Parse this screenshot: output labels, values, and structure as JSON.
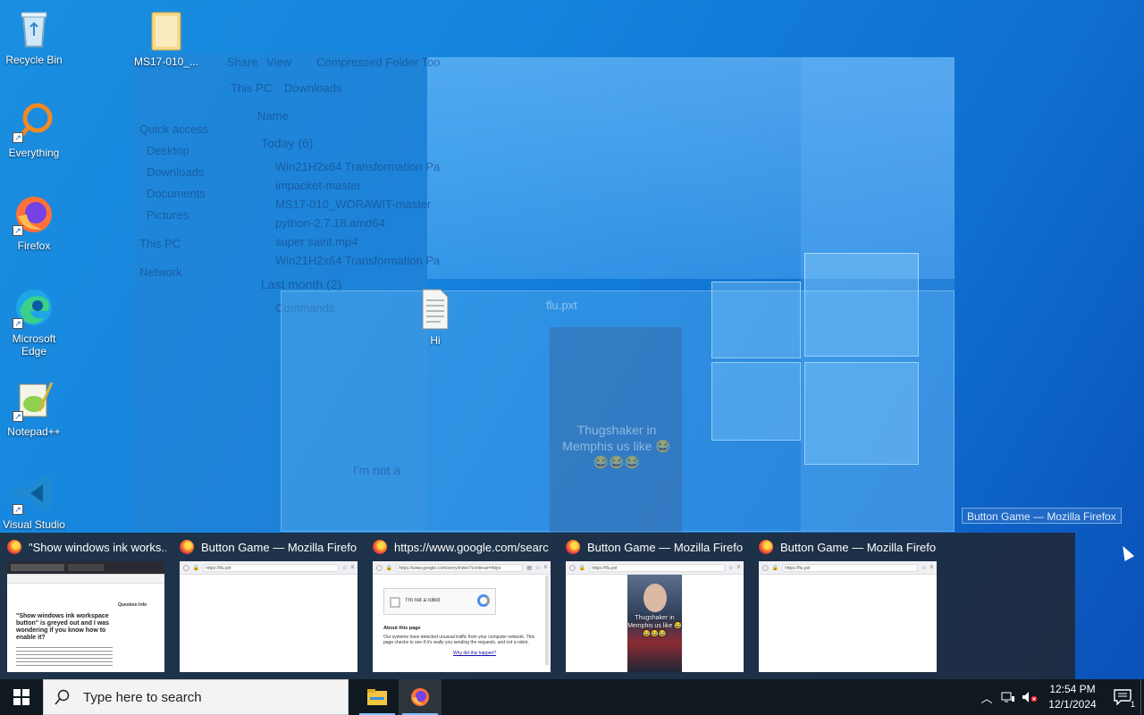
{
  "desktop": {
    "icons": [
      {
        "label": "Recycle Bin",
        "icon": "recycle-bin-icon"
      },
      {
        "label": "MS17-010_...",
        "icon": "folder-icon"
      },
      {
        "label": "Everything",
        "icon": "everything-search-icon"
      },
      {
        "label": "Firefox",
        "icon": "firefox-icon"
      },
      {
        "label": "Microsoft Edge",
        "icon": "edge-icon"
      },
      {
        "label": "Notepad++",
        "icon": "notepadpp-icon"
      },
      {
        "label": "Visual Studio",
        "icon": "vscode-icon"
      },
      {
        "label": "Hi",
        "icon": "text-file-icon"
      }
    ]
  },
  "ghost_explorer": {
    "ribbon": [
      "Share",
      "View",
      "Compressed Folder Too"
    ],
    "path": [
      "This PC",
      "Downloads"
    ],
    "column_header": "Name",
    "nav": [
      "Quick access",
      "Desktop",
      "Downloads",
      "Documents",
      "Pictures",
      "This PC",
      "Network"
    ],
    "group_today": "Today (6)",
    "files_today": [
      "Win21H2x64 Transformation Pa",
      "impacket-master",
      "MS17-010_WORAWIT-master",
      "python-2.7.18.amd64",
      "super saint.mp4",
      "Win21H2x64 Transformation Pa"
    ],
    "group_last_month": "Last month (2)",
    "files_last_month": [
      "Commands"
    ]
  },
  "ghost_browser": {
    "url": "flu.pxt",
    "captcha_text": "I'm not a",
    "caption": "Thugshaker in Memphis us like 😂😂😂😂"
  },
  "tooltip": "Button Game — Mozilla Firefox",
  "thumbnails": [
    {
      "title": "\"Show windows ink works...",
      "url": "",
      "preview": "microsoft-answers"
    },
    {
      "title": "Button Game — Mozilla Firefox",
      "url": "https://flu.pxt",
      "preview": "blank"
    },
    {
      "title": "https://www.google.com/searc...",
      "url": "https://www.google.com/sorry/index?continue=https",
      "preview": "captcha",
      "captcha": {
        "checkbox_label": "I'm not a robot",
        "about_title": "About this page",
        "about_text": "Our systems have detected unusual traffic from your computer network. This page checks to see if it's really you sending the requests, and not a robot.",
        "link": "Why did this happen?"
      }
    },
    {
      "title": "Button Game — Mozilla Firefox",
      "url": "https://flu.pxt",
      "preview": "meme",
      "caption": "Thugshaker in Memphis us like 😂😂😂😂"
    },
    {
      "title": "Button Game — Mozilla Firefox",
      "url": "https://flu.pxt",
      "preview": "blank"
    }
  ],
  "ms_answers": {
    "headline": "\"Show windows ink workspace button\" is greyed out and I was wondering if you know how to enable it?",
    "side_title": "Question Info"
  },
  "taskbar": {
    "search_placeholder": "Type here to search",
    "apps": [
      "file-explorer-icon",
      "firefox-icon"
    ],
    "clock_time": "12:54 PM",
    "clock_date": "12/1/2024",
    "notification_count": "1"
  },
  "colors": {
    "accent": "#7cc0ff",
    "taskbar": "#101820",
    "thumb_strip": "#202834"
  }
}
